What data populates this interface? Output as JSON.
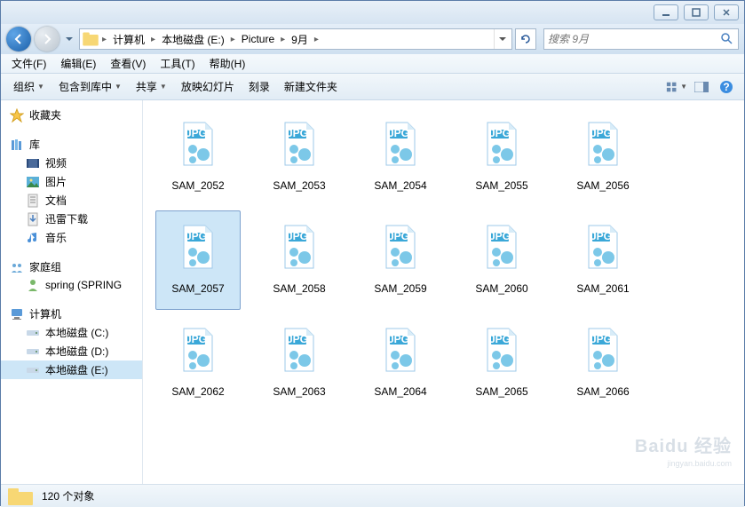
{
  "window": {
    "min_tip": "最小化",
    "max_tip": "还原",
    "close_tip": "关闭"
  },
  "breadcrumb": {
    "items": [
      "计算机",
      "本地磁盘 (E:)",
      "Picture",
      "9月"
    ]
  },
  "search": {
    "placeholder": "搜索 9月"
  },
  "menubar": {
    "items": [
      "文件(F)",
      "编辑(E)",
      "查看(V)",
      "工具(T)",
      "帮助(H)"
    ]
  },
  "toolbar": {
    "organize": "组织",
    "include": "包含到库中",
    "share": "共享",
    "slideshow": "放映幻灯片",
    "burn": "刻录",
    "newfolder": "新建文件夹"
  },
  "sidebar": {
    "favorites": "收藏夹",
    "libraries": "库",
    "lib_items": [
      "视频",
      "图片",
      "文档",
      "迅雷下载",
      "音乐"
    ],
    "homegroup": "家庭组",
    "hg_items": [
      "spring (SPRING"
    ],
    "computer": "计算机",
    "drives": [
      "本地磁盘 (C:)",
      "本地磁盘 (D:)",
      "本地磁盘 (E:)"
    ],
    "selected_drive": 2
  },
  "files": {
    "items": [
      {
        "name": "SAM_2052"
      },
      {
        "name": "SAM_2053"
      },
      {
        "name": "SAM_2054"
      },
      {
        "name": "SAM_2055"
      },
      {
        "name": "SAM_2056"
      },
      {
        "name": "SAM_2057",
        "selected": true
      },
      {
        "name": "SAM_2058"
      },
      {
        "name": "SAM_2059"
      },
      {
        "name": "SAM_2060"
      },
      {
        "name": "SAM_2061"
      },
      {
        "name": "SAM_2062"
      },
      {
        "name": "SAM_2063"
      },
      {
        "name": "SAM_2064"
      },
      {
        "name": "SAM_2065"
      },
      {
        "name": "SAM_2066"
      }
    ]
  },
  "statusbar": {
    "text": "120 个对象"
  },
  "watermark": {
    "main": "Baidu 经验",
    "sub": "jingyan.baidu.com"
  }
}
